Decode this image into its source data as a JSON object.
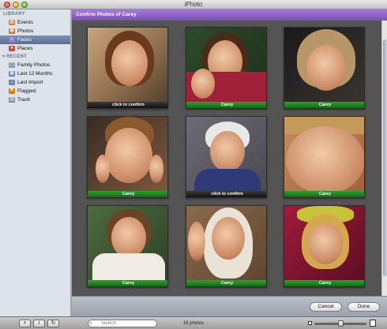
{
  "window": {
    "title": "iPhoto"
  },
  "sidebar": {
    "library_heading": "LIBRARY",
    "library_items": [
      {
        "label": "Events",
        "icon": "events-icon",
        "color": "#d9803a"
      },
      {
        "label": "Photos",
        "icon": "photos-icon",
        "color": "#c8742e"
      },
      {
        "label": "Faces",
        "icon": "faces-icon",
        "color": "#9a7ac8"
      },
      {
        "label": "Places",
        "icon": "places-icon",
        "color": "#c84a3a"
      }
    ],
    "recent_heading": "RECENT",
    "recent_items": [
      {
        "label": "Family Photos",
        "icon": "album-icon",
        "color": "#8a96a4"
      },
      {
        "label": "Last 12 Months",
        "icon": "calendar-icon",
        "color": "#5b7fb8"
      },
      {
        "label": "Last Import",
        "icon": "import-icon",
        "color": "#6a88b8"
      },
      {
        "label": "Flagged",
        "icon": "flag-icon",
        "color": "#e07a1e"
      },
      {
        "label": "Trash",
        "icon": "trash-icon",
        "color": "#7f8a94"
      }
    ]
  },
  "header": {
    "title": "Confirm Photos of Carey"
  },
  "tiles": [
    {
      "caption": "click to confirm",
      "confirmed": false
    },
    {
      "caption": "Carey",
      "confirmed": true
    },
    {
      "caption": "Carey",
      "confirmed": true
    },
    {
      "caption": "Carey",
      "confirmed": true
    },
    {
      "caption": "click to confirm",
      "confirmed": false
    },
    {
      "caption": "Carey",
      "confirmed": true
    },
    {
      "caption": "Carey",
      "confirmed": true
    },
    {
      "caption": "Carey",
      "confirmed": true
    },
    {
      "caption": "Carey",
      "confirmed": true
    }
  ],
  "actions": {
    "cancel": "Cancel",
    "done": "Done"
  },
  "toolbar": {
    "add_icon": "plus-icon",
    "info_icon": "info-icon",
    "rotate_icon": "rotate-icon",
    "search_placeholder": "Search",
    "photo_count": "16 photos"
  }
}
